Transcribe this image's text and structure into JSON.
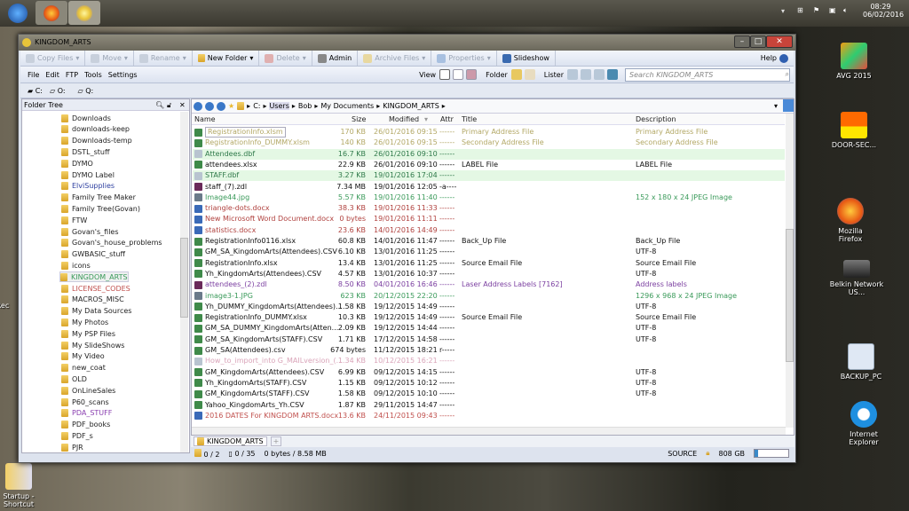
{
  "taskbar": {
    "time": "08:29",
    "date": "06/02/2016",
    "apps": [
      "start",
      "firefox",
      "directory-opus"
    ]
  },
  "desktop": {
    "icons": [
      "AVG 2015",
      "DOOR-SEC...",
      "Mozilla Firefox",
      "Belkin Network US...",
      "BACKUP_PC",
      "Internet Explorer"
    ],
    "left_icons": [
      "Rec",
      "Startup - Shortcut"
    ]
  },
  "window": {
    "title": "KINGDOM_ARTS",
    "toolbar": {
      "copy": "Copy Files",
      "move": "Move",
      "rename": "Rename",
      "new_folder": "New Folder",
      "delete": "Delete",
      "admin": "Admin",
      "archive": "Archive Files",
      "properties": "Properties",
      "slideshow": "Slideshow",
      "help": "Help"
    },
    "menu": [
      "File",
      "Edit",
      "FTP",
      "Tools",
      "Settings"
    ],
    "view_label": "View",
    "folder_label": "Folder",
    "lister_label": "Lister",
    "search_placeholder": "Search KINGDOM_ARTS",
    "drives": [
      "C:",
      "O:",
      "Q:"
    ],
    "tree_title": "Folder Tree",
    "tree": [
      {
        "name": "Downloads"
      },
      {
        "name": "downloads-keep"
      },
      {
        "name": "Downloads-temp"
      },
      {
        "name": "DSTL_stuff"
      },
      {
        "name": "DYMO"
      },
      {
        "name": "DYMO Label"
      },
      {
        "name": "ElviSupplies",
        "color": "#2d3fa0"
      },
      {
        "name": "Family Tree Maker"
      },
      {
        "name": "Family Tree(Govan)"
      },
      {
        "name": "FTW"
      },
      {
        "name": "Govan's_files"
      },
      {
        "name": "Govan's_house_problems"
      },
      {
        "name": "GWBASIC_stuff"
      },
      {
        "name": "icons"
      },
      {
        "name": "KINGDOM_ARTS",
        "color": "#3a9a5a",
        "selected": true
      },
      {
        "name": "LICENSE_CODES",
        "color": "#c0504d"
      },
      {
        "name": "MACROS_MISC"
      },
      {
        "name": "My Data Sources"
      },
      {
        "name": "My Photos"
      },
      {
        "name": "My PSP Files"
      },
      {
        "name": "My SlideShows"
      },
      {
        "name": "My Video"
      },
      {
        "name": "new_coat"
      },
      {
        "name": "OLD"
      },
      {
        "name": "OnLineSales"
      },
      {
        "name": "P60_scans"
      },
      {
        "name": "PDA_STUFF",
        "color": "#8a3fb0"
      },
      {
        "name": "PDF_books"
      },
      {
        "name": "PDF_s"
      },
      {
        "name": "PJR"
      }
    ],
    "breadcrumb": [
      "C:",
      "Users",
      "Bob",
      "My Documents",
      "KINGDOM_ARTS"
    ],
    "columns": {
      "name": "Name",
      "size": "Size",
      "modified": "Modified",
      "attr": "Attr",
      "title": "Title",
      "description": "Description"
    },
    "files": [
      {
        "name": "RegistrationInfo.xlsm",
        "size": "170 KB",
        "modified": "26/01/2016  09:15",
        "attr": "------",
        "title": "Primary Address File",
        "desc": "Primary Address File",
        "color": "#b3a866",
        "icon": "excel"
      },
      {
        "name": "RegistrationInfo_DUMMY.xlsm",
        "size": "140 KB",
        "modified": "26/01/2016  09:15",
        "attr": "------",
        "title": "Secondary Address File",
        "desc": "Secondary Address File",
        "color": "#b3a866",
        "icon": "excel"
      },
      {
        "name": "Attendees.dbf",
        "size": "16.7 KB",
        "modified": "26/01/2016  09:10",
        "attr": "------",
        "title": "",
        "desc": "",
        "color": "#2f7a4a",
        "bg": "#e4f8e4",
        "icon": "doc"
      },
      {
        "name": "attendees.xlsx",
        "size": "22.9 KB",
        "modified": "26/01/2016  09:10",
        "attr": "------",
        "title": "LABEL File",
        "desc": "LABEL File",
        "color": "#111",
        "icon": "excel"
      },
      {
        "name": "STAFF.dbf",
        "size": "3.27 KB",
        "modified": "19/01/2016  17:04",
        "attr": "------",
        "title": "",
        "desc": "",
        "color": "#2f7a4a",
        "bg": "#e4f8e4",
        "icon": "doc"
      },
      {
        "name": "staff_(7).zdl",
        "size": "7.34 MB",
        "modified": "19/01/2016  12:05",
        "attr": "-a----",
        "title": "",
        "desc": "",
        "color": "#111",
        "icon": "zdl"
      },
      {
        "name": "Image44.jpg",
        "size": "5.57 KB",
        "modified": "19/01/2016  11:40",
        "attr": "------",
        "title": "",
        "desc": "152 x 180 x 24 JPEG Image",
        "color": "#3a9a5a",
        "icon": "image"
      },
      {
        "name": "triangle-dots.docx",
        "size": "38.3 KB",
        "modified": "19/01/2016  11:33",
        "attr": "------",
        "title": "",
        "desc": "",
        "color": "#b0413e",
        "icon": "word"
      },
      {
        "name": "New Microsoft Word Document.docx",
        "size": "0 bytes",
        "modified": "19/01/2016  11:11",
        "attr": "------",
        "title": "",
        "desc": "",
        "color": "#b0413e",
        "icon": "word"
      },
      {
        "name": "statistics.docx",
        "size": "23.6 KB",
        "modified": "14/01/2016  14:49",
        "attr": "------",
        "title": "",
        "desc": "",
        "color": "#b0413e",
        "icon": "word"
      },
      {
        "name": "RegistrationInfo0116.xlsx",
        "size": "60.8 KB",
        "modified": "14/01/2016  11:47",
        "attr": "------",
        "title": "Back_Up File",
        "desc": "Back_Up File",
        "color": "#111",
        "icon": "excel"
      },
      {
        "name": "GM_SA_KingdomArts(Attendees).CSV",
        "size": "6.10 KB",
        "modified": "13/01/2016  11:25",
        "attr": "------",
        "title": "",
        "desc": "UTF-8",
        "color": "#111",
        "icon": "excel"
      },
      {
        "name": "RegistrationInfo.xlsx",
        "size": "13.4 KB",
        "modified": "13/01/2016  11:25",
        "attr": "------",
        "title": "Source Email File",
        "desc": "Source Email File",
        "color": "#111",
        "icon": "excel"
      },
      {
        "name": "Yh_KingdomArts(Attendees).CSV",
        "size": "4.57 KB",
        "modified": "13/01/2016  10:37",
        "attr": "------",
        "title": "",
        "desc": "UTF-8",
        "color": "#111",
        "icon": "excel"
      },
      {
        "name": "attendees_(2).zdl",
        "size": "8.50 KB",
        "modified": "04/01/2016  16:46",
        "attr": "------",
        "title": "Laser Address Labels  [7162]",
        "desc": "Address labels",
        "color": "#7b3fa0",
        "icon": "zdl"
      },
      {
        "name": "image3-1.JPG",
        "size": "623 KB",
        "modified": "20/12/2015  22:20",
        "attr": "------",
        "title": "",
        "desc": "1296 x 968 x 24 JPEG Image",
        "color": "#3a9a5a",
        "icon": "image"
      },
      {
        "name": "Yh_DUMMY_KingdomArts(Attendees)...",
        "size": "1.58 KB",
        "modified": "19/12/2015  14:49",
        "attr": "------",
        "title": "",
        "desc": "UTF-8",
        "color": "#111",
        "icon": "excel"
      },
      {
        "name": "RegistrationInfo_DUMMY.xlsx",
        "size": "10.3 KB",
        "modified": "19/12/2015  14:49",
        "attr": "------",
        "title": "Source Email File",
        "desc": "Source Email File",
        "color": "#111",
        "icon": "excel"
      },
      {
        "name": "GM_SA_DUMMY_KingdomArts(Atten...",
        "size": "2.09 KB",
        "modified": "19/12/2015  14:44",
        "attr": "------",
        "title": "",
        "desc": "UTF-8",
        "color": "#111",
        "icon": "excel"
      },
      {
        "name": "GM_SA_KingdomArts(STAFF).CSV",
        "size": "1.71 KB",
        "modified": "17/12/2015  14:58",
        "attr": "------",
        "title": "",
        "desc": "UTF-8",
        "color": "#111",
        "icon": "excel"
      },
      {
        "name": "GM_SA(Attendees).csv",
        "size": "674 bytes",
        "modified": "11/12/2015  18:21",
        "attr": "r-----",
        "title": "",
        "desc": "",
        "color": "#111",
        "icon": "excel"
      },
      {
        "name": "How_to_import_into G_MAILversion_(...",
        "size": "1.34 KB",
        "modified": "10/12/2015  16:21",
        "attr": "------",
        "title": "",
        "desc": "",
        "color": "#d9a3b8",
        "icon": "doc"
      },
      {
        "name": "GM_KingdomArts(Attendees).CSV",
        "size": "6.99 KB",
        "modified": "09/12/2015  14:15",
        "attr": "------",
        "title": "",
        "desc": "UTF-8",
        "color": "#111",
        "icon": "excel"
      },
      {
        "name": "Yh_KingdomArts(STAFF).CSV",
        "size": "1.15 KB",
        "modified": "09/12/2015  10:12",
        "attr": "------",
        "title": "",
        "desc": "UTF-8",
        "color": "#111",
        "icon": "excel"
      },
      {
        "name": "GM_KingdomArts(STAFF).CSV",
        "size": "1.58 KB",
        "modified": "09/12/2015  10:10",
        "attr": "------",
        "title": "",
        "desc": "UTF-8",
        "color": "#111",
        "icon": "excel"
      },
      {
        "name": "Yahoo_KingdomArts_Yh.CSV",
        "size": "1.87 KB",
        "modified": "29/11/2015  14:47",
        "attr": "------",
        "title": "",
        "desc": "",
        "color": "#111",
        "icon": "excel"
      },
      {
        "name": "2016 DATES For KINGDOM ARTS.docx",
        "size": "13.6 KB",
        "modified": "24/11/2015  09:43",
        "attr": "------",
        "title": "",
        "desc": "",
        "color": "#c0504d",
        "icon": "word"
      }
    ],
    "tab": "KINGDOM_ARTS",
    "status": {
      "folders": "0 / 2",
      "files": "0 / 35",
      "bytes": "0 bytes / 8.58 MB",
      "source": "SOURCE",
      "free": "808 GB",
      "free_fraction": 0.1
    }
  }
}
